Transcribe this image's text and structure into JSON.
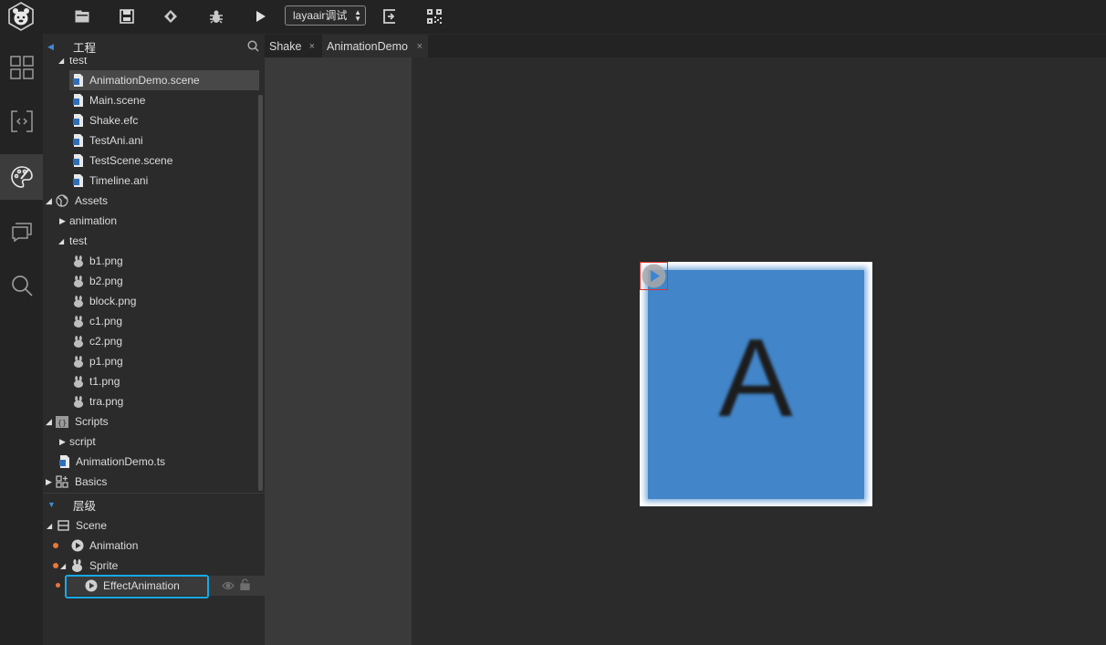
{
  "toolbar": {
    "engine_select": "layaair调试"
  },
  "panels": {
    "project_title": "工程",
    "hierarchy_title": "层级"
  },
  "project_tree": {
    "top_partial": "test",
    "scenes": [
      "AnimationDemo.scene",
      "Main.scene",
      "Shake.efc",
      "TestAni.ani",
      "TestScene.scene",
      "Timeline.ani"
    ],
    "assets_label": "Assets",
    "animation_folder": "animation",
    "test_folder": "test",
    "test_files": [
      "b1.png",
      "b2.png",
      "block.png",
      "c1.png",
      "c2.png",
      "p1.png",
      "t1.png",
      "tra.png"
    ],
    "scripts_label": "Scripts",
    "script_folder": "script",
    "script_file": "AnimationDemo.ts",
    "basics_label": "Basics"
  },
  "hierarchy": {
    "scene": "Scene",
    "animation": "Animation",
    "sprite": "Sprite",
    "effect": "EffectAnimation"
  },
  "tabs": [
    {
      "label": "Shake",
      "close": "×"
    },
    {
      "label": "AnimationDemo",
      "close": "×"
    }
  ],
  "canvas": {
    "sprite_letter": "A",
    "sprite_color": "#4285c9",
    "marker_color": "#d8342f"
  },
  "colors": {
    "accent": "#3d8ad8",
    "selection_outline": "#17a9e8",
    "dot": "#e9763a"
  }
}
